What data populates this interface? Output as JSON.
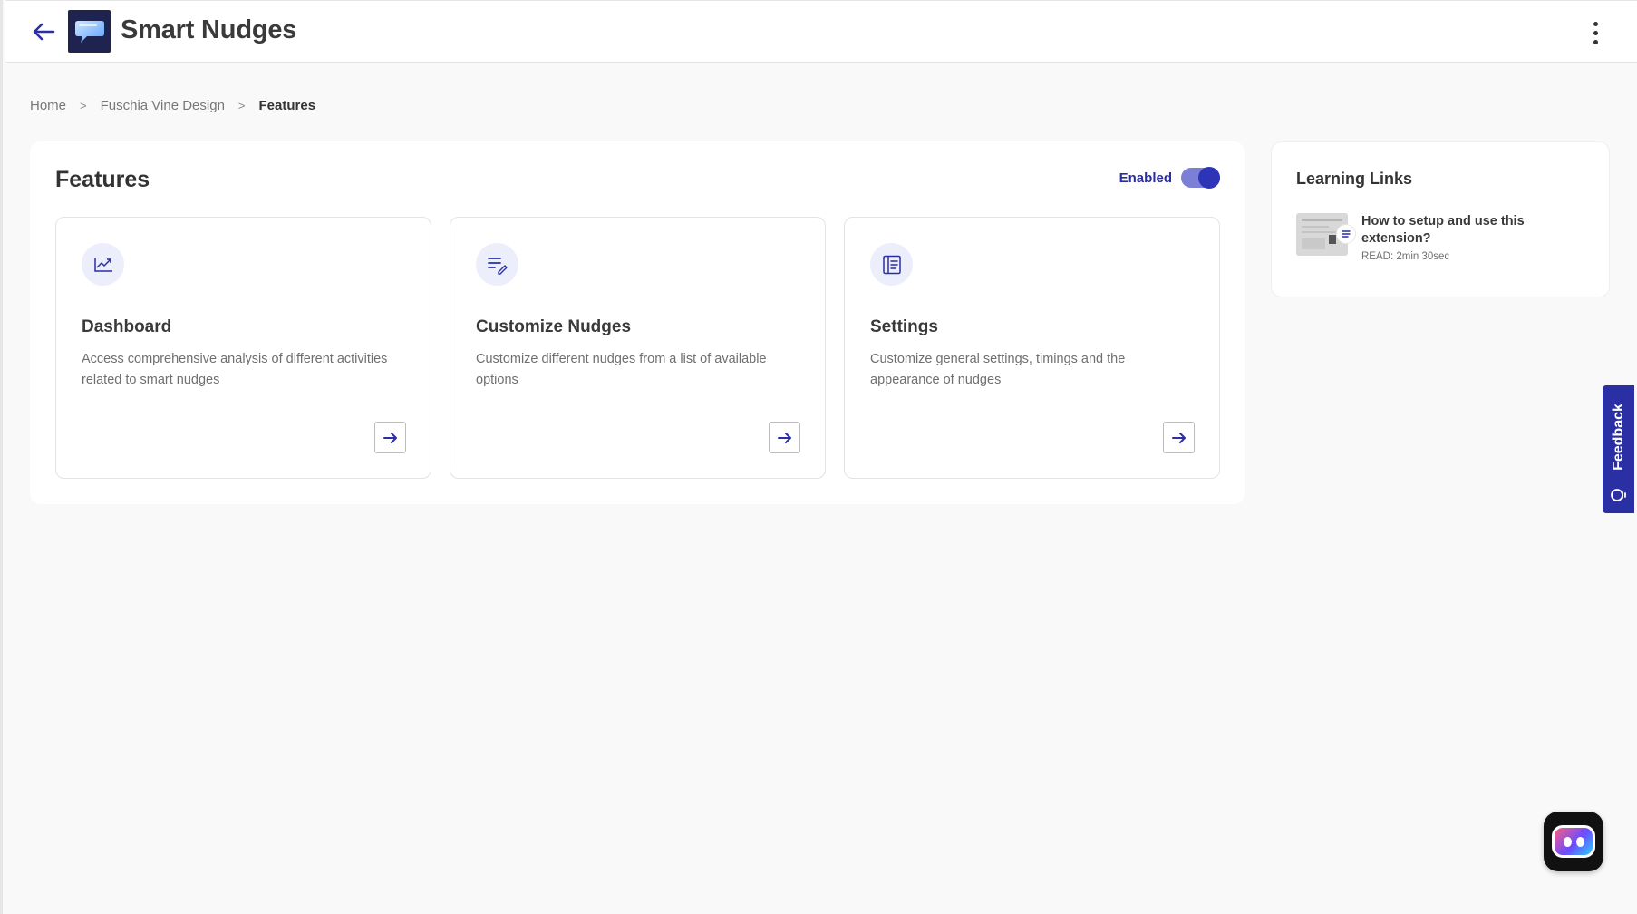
{
  "header": {
    "title": "Smart Nudges",
    "back_icon": "arrow-left-icon",
    "logo_icon": "speech-bubble-logo",
    "menu_icon": "kebab-menu-icon"
  },
  "breadcrumb": {
    "items": [
      "Home",
      "Fuschia Vine Design"
    ],
    "current": "Features",
    "separator": ">"
  },
  "features": {
    "title": "Features",
    "toggle_label": "Enabled",
    "toggle_on": true,
    "cards": [
      {
        "title": "Dashboard",
        "description": "Access comprehensive analysis of different activities related to smart nudges",
        "icon": "trend-chart-icon"
      },
      {
        "title": "Customize Nudges",
        "description": "Customize different nudges from a list of available options",
        "icon": "list-edit-icon"
      },
      {
        "title": "Settings",
        "description": "Customize general settings, timings and the appearance of nudges",
        "icon": "document-panel-icon"
      }
    ]
  },
  "learning": {
    "title": "Learning Links",
    "items": [
      {
        "title": "How to setup and use this extension?",
        "meta": "READ: 2min 30sec",
        "icon": "document-icon"
      }
    ]
  },
  "feedback": {
    "label": "Feedback",
    "icon": "lightbulb-icon"
  },
  "colors": {
    "accent": "#2a2fa3",
    "toggle_track": "#7b80d6",
    "toggle_knob": "#2e34b8",
    "icon_bg": "#eceefb",
    "page_bg": "#f9f9f9"
  }
}
